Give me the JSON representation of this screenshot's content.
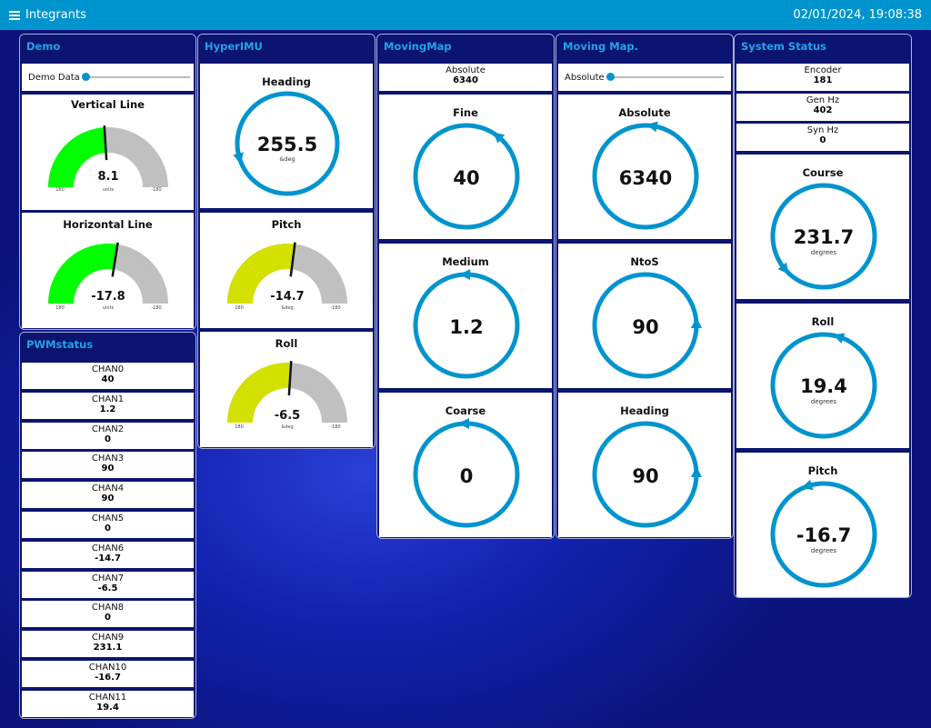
{
  "app": {
    "title": "Integrants",
    "datetime": "02/01/2024, 19:08:38",
    "menu_icon": "hamburger-menu-icon"
  },
  "colors": {
    "topbar": "#0094ce",
    "compass": "#0094ce",
    "gauge_green": "#00ff00",
    "gauge_yellow": "#d4e000",
    "gauge_gray": "#c0c0c0",
    "header_text": "#21a4e8"
  },
  "demo": {
    "title": "Demo",
    "slider_label": "Demo Data",
    "vertical_line": {
      "title": "Vertical Line",
      "value": "8.1",
      "units": "units",
      "min_label": "180",
      "max_label": "-180",
      "fraction": 0.48
    },
    "horizontal_line": {
      "title": "Horizontal Line",
      "value": "-17.8",
      "units": "units",
      "min_label": "180",
      "max_label": "-180",
      "fraction": 0.55
    }
  },
  "pwmstatus": {
    "title": "PWMstatus",
    "channels": [
      {
        "label": "CHAN0",
        "value": "40"
      },
      {
        "label": "CHAN1",
        "value": "1.2"
      },
      {
        "label": "CHAN2",
        "value": "0"
      },
      {
        "label": "CHAN3",
        "value": "90"
      },
      {
        "label": "CHAN4",
        "value": "90"
      },
      {
        "label": "CHAN5",
        "value": "0"
      },
      {
        "label": "CHAN6",
        "value": "-14.7"
      },
      {
        "label": "CHAN7",
        "value": "-6.5"
      },
      {
        "label": "CHAN8",
        "value": "0"
      },
      {
        "label": "CHAN9",
        "value": "231.1"
      },
      {
        "label": "CHAN10",
        "value": "-16.7"
      },
      {
        "label": "CHAN11",
        "value": "19.4"
      }
    ]
  },
  "hyperimu": {
    "title": "HyperIMU",
    "heading": {
      "title": "Heading",
      "value": "255.5",
      "units": "&deg",
      "angle": 255.5
    },
    "pitch": {
      "title": "Pitch",
      "value": "-14.7",
      "units": "&deg",
      "min_label": "180",
      "max_label": "-180",
      "fraction": 0.54
    },
    "roll": {
      "title": "Roll",
      "value": "-6.5",
      "units": "&deg",
      "min_label": "180",
      "max_label": "-180",
      "fraction": 0.52
    }
  },
  "movingmap": {
    "title": "MovingMap",
    "absolute_label": "Absolute",
    "absolute_value": "6340",
    "fine": {
      "title": "Fine",
      "value": "40",
      "angle": 40
    },
    "medium": {
      "title": "Medium",
      "value": "1.2",
      "angle": 1.2
    },
    "coarse": {
      "title": "Coarse",
      "value": "0",
      "angle": 0
    }
  },
  "movingmap2": {
    "title": "Moving Map.",
    "slider_label": "Absolute",
    "absolute": {
      "title": "Absolute",
      "value": "6340",
      "angle": 10
    },
    "ntos": {
      "title": "NtoS",
      "value": "90",
      "angle": 90
    },
    "heading": {
      "title": "Heading",
      "value": "90",
      "angle": 90
    }
  },
  "system_status": {
    "title": "System Status",
    "encoder": {
      "label": "Encoder",
      "value": "181"
    },
    "gen_hz": {
      "label": "Gen Hz",
      "value": "402"
    },
    "syn_hz": {
      "label": "Syn Hz",
      "value": "0"
    },
    "course": {
      "title": "Course",
      "value": "231.7",
      "units": "degrees",
      "angle": 231.7
    },
    "roll": {
      "title": "Roll",
      "value": "19.4",
      "units": "degrees",
      "angle": 19.4
    },
    "pitch": {
      "title": "Pitch",
      "value": "-16.7",
      "units": "degrees",
      "angle": -16.7
    }
  }
}
